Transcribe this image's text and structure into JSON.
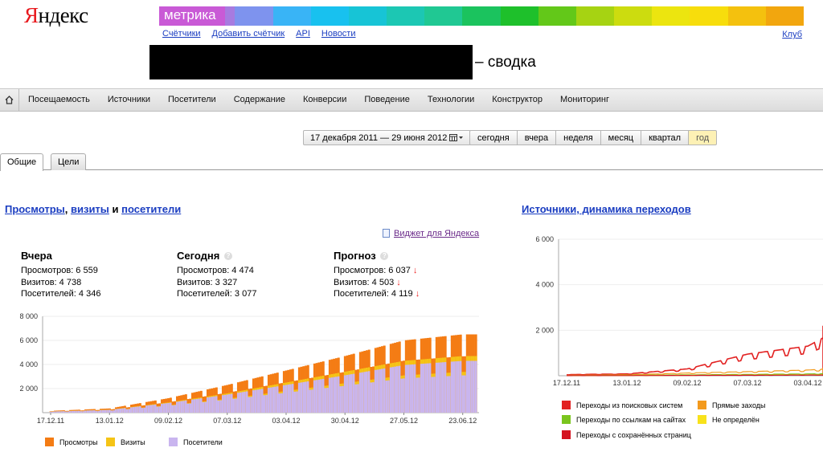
{
  "brand": {
    "logo_first": "Я",
    "logo_rest": "ндекс",
    "product": "метрика"
  },
  "header_bar_colors": [
    "#c95ad6",
    "#a77be0",
    "#7e93ee",
    "#39b4f6",
    "#18c1ef",
    "#17c4d6",
    "#1cc7b3",
    "#20c893",
    "#1bc35e",
    "#1ec02b",
    "#63c819",
    "#a6d312",
    "#ccdc0f",
    "#ece50f",
    "#f7dd0c",
    "#f4c10e",
    "#f2a60e"
  ],
  "topnav": [
    "Счётчики",
    "Добавить счётчик",
    "API",
    "Новости"
  ],
  "club": "Клуб",
  "page_title_suffix": "– сводка",
  "menu": [
    "Посещаемость",
    "Источники",
    "Посетители",
    "Содержание",
    "Конверсии",
    "Поведение",
    "Технологии",
    "Конструктор",
    "Мониторинг"
  ],
  "date_range": "17 декабря 2011 — 29 июня 2012",
  "periods": [
    "сегодня",
    "вчера",
    "неделя",
    "месяц",
    "квартал",
    "год"
  ],
  "active_period": "год",
  "tabs": [
    "Общие",
    "Цели"
  ],
  "left_section": {
    "part1": "Просмотры",
    "sep1": ", ",
    "part2": "визиты",
    "sep2": " и ",
    "part3": "посетители"
  },
  "widget_link": "Виджет для Яндекса",
  "cards": [
    {
      "title": "Вчера",
      "bg": "#e9ebf6",
      "rows": [
        "Просмотров: 6 559",
        "Визитов: 4 738",
        "Посетителей: 4 346"
      ]
    },
    {
      "title": "Сегодня",
      "bg": "#e3ecf7",
      "rows": [
        "Просмотров: 4 474",
        "Визитов: 3 327",
        "Посетителей: 3 077"
      ]
    },
    {
      "title": "Прогноз",
      "bg": "#fdf3cc",
      "rows": [
        "Просмотров: 6 037",
        "Визитов: 4 503",
        "Посетителей: 4 119"
      ]
    }
  ],
  "help_mark": "?",
  "down_arrow": "↓",
  "right_section_title": "Источники, динамика переходов",
  "chart_data": [
    {
      "type": "bar",
      "stacked_overlay": true,
      "ylim": [
        0,
        8000
      ],
      "yticks": [
        "8 000",
        "6 000",
        "4 000",
        "2 000"
      ],
      "x_tick_labels": [
        "17.12.11",
        "13.01.12",
        "09.02.12",
        "07.03.12",
        "03.04.12",
        "30.04.12",
        "27.05.12",
        "23.06.12"
      ],
      "series": [
        {
          "name": "Просмотры",
          "color": "#f47c14"
        },
        {
          "name": "Визиты",
          "color": "#f5c416"
        },
        {
          "name": "Посетители",
          "color": "#c9b5ef"
        }
      ],
      "anchor_values": [
        {
          "date": "2011-12-17",
          "Просмотры": 150,
          "Визиты": 100,
          "Посетители": 90
        },
        {
          "date": "2012-01-13",
          "Просмотры": 350,
          "Визиты": 250,
          "Посетители": 230
        },
        {
          "date": "2012-02-09",
          "Просмотры": 1200,
          "Визиты": 850,
          "Посетители": 800
        },
        {
          "date": "2012-03-07",
          "Просмотры": 2300,
          "Визиты": 1600,
          "Посетители": 1500
        },
        {
          "date": "2012-04-03",
          "Просмотры": 3500,
          "Визиты": 2500,
          "Посетители": 2300
        },
        {
          "date": "2012-04-30",
          "Просмотры": 4700,
          "Визиты": 3400,
          "Посетители": 3100
        },
        {
          "date": "2012-05-27",
          "Просмотры": 6000,
          "Визиты": 4300,
          "Посетители": 3950
        },
        {
          "date": "2012-06-23",
          "Просмотры": 6500,
          "Визиты": 4700,
          "Посетители": 4300
        }
      ]
    },
    {
      "type": "line",
      "ylim": [
        0,
        6000
      ],
      "yticks": [
        "6 000",
        "4 000",
        "2 000"
      ],
      "x_tick_labels": [
        "17.12.11",
        "13.01.12",
        "09.02.12",
        "07.03.12",
        "03.04.12"
      ],
      "series": [
        {
          "name": "Переходы из поисковых систем",
          "color": "#e22121",
          "points": [
            [
              "2011-12-17",
              50
            ],
            [
              "2012-01-13",
              80
            ],
            [
              "2012-02-09",
              300
            ],
            [
              "2012-03-07",
              950
            ],
            [
              "2012-04-03",
              1300
            ],
            [
              "2012-04-20",
              2200
            ]
          ]
        },
        {
          "name": "Прямые заходы",
          "color": "#f39a1d",
          "points": [
            [
              "2011-12-17",
              20
            ],
            [
              "2012-01-13",
              40
            ],
            [
              "2012-02-09",
              120
            ],
            [
              "2012-03-07",
              180
            ],
            [
              "2012-04-03",
              250
            ],
            [
              "2012-04-20",
              350
            ]
          ]
        },
        {
          "name": "Переходы по ссылкам на сайтах",
          "color": "#7ac51e",
          "points": [
            [
              "2011-12-17",
              10
            ],
            [
              "2012-01-13",
              20
            ],
            [
              "2012-02-09",
              40
            ],
            [
              "2012-03-07",
              60
            ],
            [
              "2012-04-03",
              80
            ],
            [
              "2012-04-20",
              100
            ]
          ]
        },
        {
          "name": "Не определён",
          "color": "#f8e21b",
          "points": [
            [
              "2011-12-17",
              5
            ],
            [
              "2012-01-13",
              10
            ],
            [
              "2012-02-09",
              20
            ],
            [
              "2012-03-07",
              30
            ],
            [
              "2012-04-03",
              40
            ],
            [
              "2012-04-20",
              50
            ]
          ]
        },
        {
          "name": "Переходы с сохранённых страниц",
          "color": "#d4121f",
          "points": [
            [
              "2011-12-17",
              5
            ],
            [
              "2012-01-13",
              8
            ],
            [
              "2012-02-09",
              15
            ],
            [
              "2012-03-07",
              20
            ],
            [
              "2012-04-03",
              30
            ],
            [
              "2012-04-20",
              40
            ]
          ]
        }
      ]
    }
  ]
}
